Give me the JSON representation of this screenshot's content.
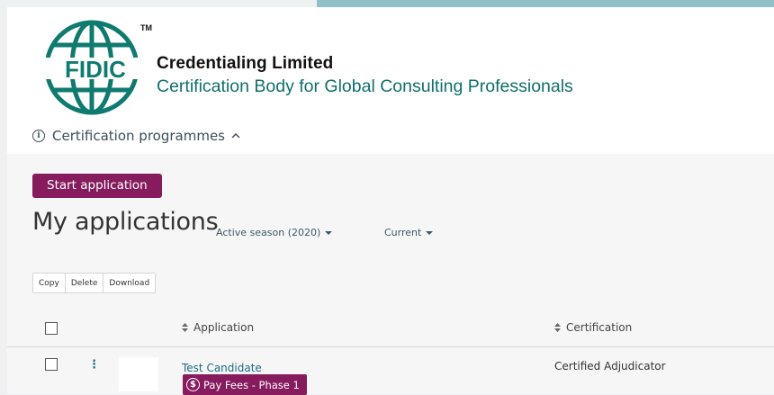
{
  "brand": {
    "name": "Credentialing Limited",
    "tagline": "Certification Body for Global Consulting Professionals",
    "logo_text": "FIDIC",
    "logo_tm": "TM"
  },
  "programmes": {
    "label": "Certification programmes",
    "icon": "info-icon",
    "toggle_icon": "chevron-up-icon"
  },
  "actions": {
    "start_label": "Start application"
  },
  "page": {
    "title": "My applications"
  },
  "filters": {
    "season": "Active season (2020)",
    "status": "Current"
  },
  "toolbar": {
    "copy": "Copy",
    "delete": "Delete",
    "download": "Download"
  },
  "table": {
    "columns": {
      "application": "Application",
      "certification": "Certification"
    },
    "rows": [
      {
        "application": "Test Candidate",
        "badge": "Pay Fees - Phase 1",
        "badge_icon": "dollar-icon",
        "certification": "Certified Adjudicator"
      }
    ]
  },
  "colors": {
    "brand_green": "#0f7a6f",
    "accent_purple": "#861b5d",
    "link_blue": "#1d6b86",
    "top_strip": "#8fc1c7"
  }
}
